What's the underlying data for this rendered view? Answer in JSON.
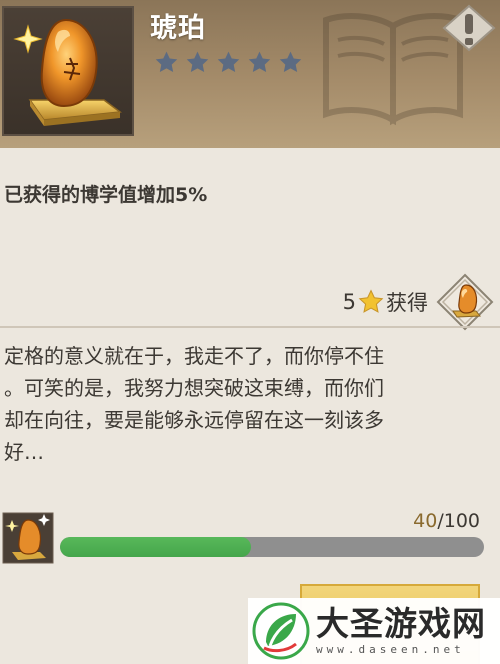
{
  "item": {
    "name": "琥珀",
    "stars_total": 5,
    "stars_filled": 0,
    "star_color": "#5c6b82"
  },
  "bonus_text": "已获得的博学值增加5%",
  "reward": {
    "count": "5",
    "label": "获得",
    "star_color": "#f2c230"
  },
  "description": "定格的意义就在于，我走不了，而你停不住\n。可笑的是，我努力想突破这束缚，而你们\n却在向往，要是能够永远停留在这一刻该多\n好…",
  "progress": {
    "current": "40",
    "separator": "/",
    "max": "100",
    "fraction": 0.45,
    "fill_color": "#4caf50",
    "track_color": "#8f8f8f"
  },
  "watermark": {
    "title": "大圣游戏网",
    "url": "www.daseen.net"
  },
  "icons": {
    "header": "alert-icon",
    "background": "open-book-icon",
    "item": "amber-icon",
    "reward": "star-icon"
  }
}
